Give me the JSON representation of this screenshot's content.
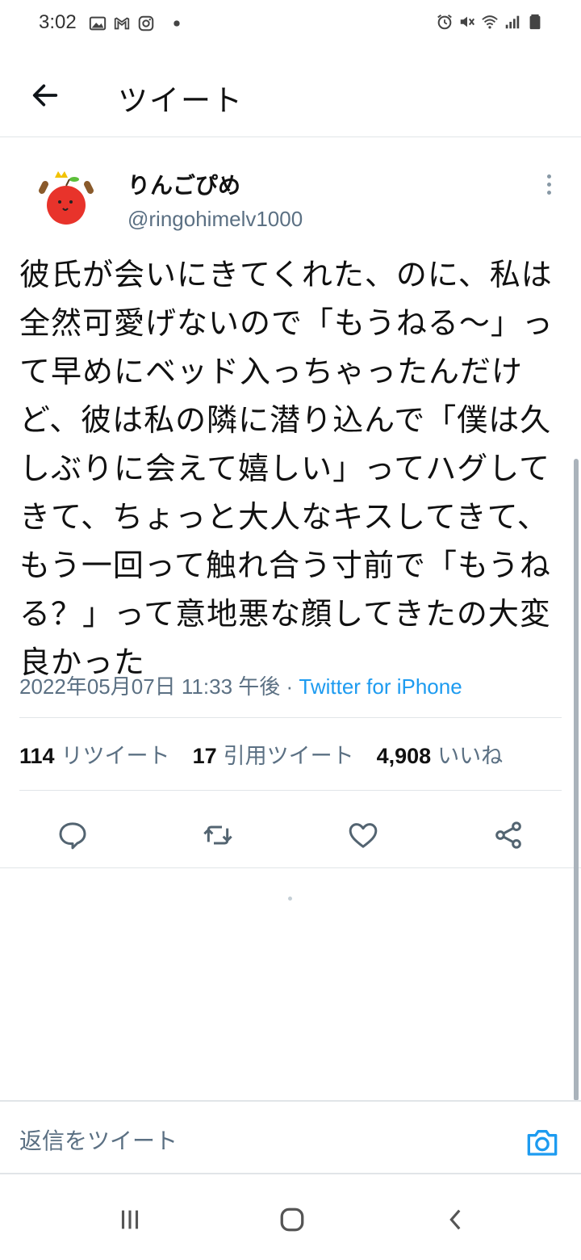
{
  "status_bar": {
    "time": "3:02",
    "left_icons": [
      "gallery-icon",
      "gmail-icon",
      "instagram-icon",
      "dot-icon"
    ],
    "right_icons": [
      "alarm-icon",
      "mute-icon",
      "wifi-icon",
      "signal-icon",
      "battery-icon"
    ]
  },
  "header": {
    "title": "ツイート"
  },
  "tweet": {
    "display_name": "りんごぴめ",
    "handle": "@ringohimelv1000",
    "text": "彼氏が会いにきてくれた、のに、私は全然可愛げないので「もうねる〜」って早めにベッド入っちゃったんだけど、彼は私の隣に潜り込んで「僕は久しぶりに会えて嬉しい」ってハグしてきて、ちょっと大人なキスしてきて、もう一回って触れ合う寸前で「もうねる？」って意地悪な顔してきたの大変良かった",
    "timestamp": "2022年05月07日 11:33 午後",
    "separator": " · ",
    "source": "Twitter for iPhone"
  },
  "stats": {
    "retweets_count": "114",
    "retweets_label": "リツイート",
    "quotes_count": "17",
    "quotes_label": "引用ツイート",
    "likes_count": "4,908",
    "likes_label": "いいね"
  },
  "colors": {
    "accent": "#1d9bf0",
    "secondary_text": "#5b7083",
    "icon": "#536471",
    "divider": "#e1e5e8"
  },
  "reply": {
    "placeholder": "返信をツイート"
  }
}
